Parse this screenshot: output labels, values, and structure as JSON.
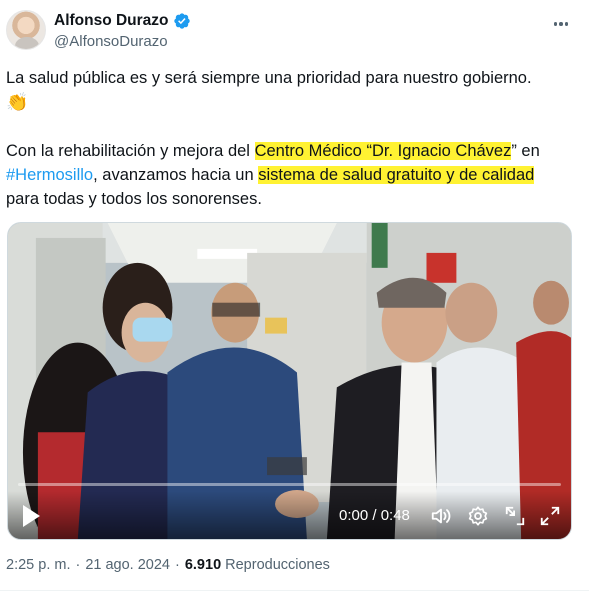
{
  "author": {
    "display_name": "Alfonso Durazo",
    "handle": "@AlfonsoDurazo",
    "verified": true,
    "verified_color": "#1d9bf0"
  },
  "tweet": {
    "line1": "La salud pública es y será siempre una prioridad para nuestro gobierno.",
    "emoji": "👏",
    "p2_pre": "Con la rehabilitación y mejora del ",
    "p2_hl1": "Centro Médico “Dr. Ignacio Chávez",
    "p2_mid1": "” en",
    "p2_hashtag": "#Hermosillo",
    "p2_mid2": ", avanzamos hacia un ",
    "p2_hl2": "sistema de salud gratuito y de calidad",
    "p2_end": "para todas y todos los sonorenses.",
    "highlight_color": "#fff232",
    "link_color": "#1d9bf0"
  },
  "video": {
    "time": "0:00 / 0:48",
    "icons": [
      "play-icon",
      "volume-icon",
      "settings-icon",
      "exit-fullscreen-icon",
      "fullscreen-icon"
    ]
  },
  "meta": {
    "time": "2:25 p. m.",
    "separator": "·",
    "date": "21 ago. 2024",
    "views": "6.910",
    "views_label": "Reproducciones"
  }
}
